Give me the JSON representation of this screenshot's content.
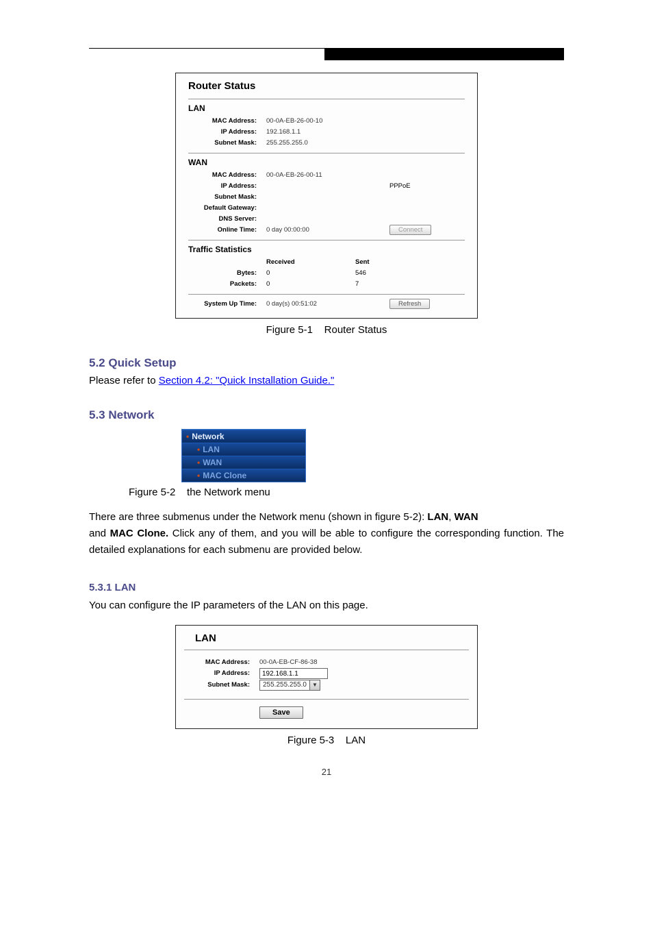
{
  "fig1": {
    "title": "Router Status",
    "lan": {
      "title": "LAN",
      "mac_label": "MAC Address:",
      "mac": "00-0A-EB-26-00-10",
      "ip_label": "IP Address:",
      "ip": "192.168.1.1",
      "mask_label": "Subnet Mask:",
      "mask": "255.255.255.0"
    },
    "wan": {
      "title": "WAN",
      "mac_label": "MAC Address:",
      "mac": "00-0A-EB-26-00-11",
      "ip_label": "IP Address:",
      "ip": "",
      "conn_type": "PPPoE",
      "mask_label": "Subnet Mask:",
      "mask": "",
      "gw_label": "Default Gateway:",
      "gw": "",
      "dns_label": "DNS Server:",
      "dns": "",
      "online_label": "Online Time:",
      "online": "0 day 00:00:00",
      "connect_btn": "Connect"
    },
    "traffic": {
      "title": "Traffic Statistics",
      "head_recv": "Received",
      "head_sent": "Sent",
      "bytes_label": "Bytes:",
      "bytes_recv": "0",
      "bytes_sent": "546",
      "pkts_label": "Packets:",
      "pkts_recv": "0",
      "pkts_sent": "7"
    },
    "uptime": {
      "label": "System Up Time:",
      "value": "0 day(s) 00:51:02",
      "refresh_btn": "Refresh"
    }
  },
  "fig1_caption": "Figure 5-1    Router Status",
  "section52": "5.2  Quick Setup",
  "ref_text_before": "Please refer to ",
  "ref_link": "Section 4.2: \"Quick Installation Guide.\"",
  "section53": "5.3  Network",
  "fig2": {
    "rows": [
      {
        "label": "Network",
        "cls": "top"
      },
      {
        "label": "LAN",
        "cls": "sub"
      },
      {
        "label": "WAN",
        "cls": "sub"
      },
      {
        "label": "MAC Clone",
        "cls": "sub"
      }
    ]
  },
  "fig2_caption": "Figure 5-2    the Network menu",
  "para1a": "There are three submenus under the Network menu (shown in figure 5-2): ",
  "para1b": "LAN",
  "para1c": ", ",
  "para1d": "WAN",
  "para2a": "and ",
  "para2b": "MAC Clone. ",
  "para2c": "Click any of them, and you will be able to configure the corresponding function. The detailed explanations for each submenu are provided below.",
  "section531": "5.3.1  LAN",
  "lan_intro": "You can configure the IP parameters of the LAN on this page.",
  "fig3": {
    "title": "LAN",
    "mac_label": "MAC Address:",
    "mac": "00-0A-EB-CF-86-38",
    "ip_label": "IP Address:",
    "ip": "192.168.1.1",
    "mask_label": "Subnet Mask:",
    "mask": "255.255.255.0",
    "save": "Save"
  },
  "fig3_caption": "Figure 5-3    LAN",
  "page_no": "21"
}
